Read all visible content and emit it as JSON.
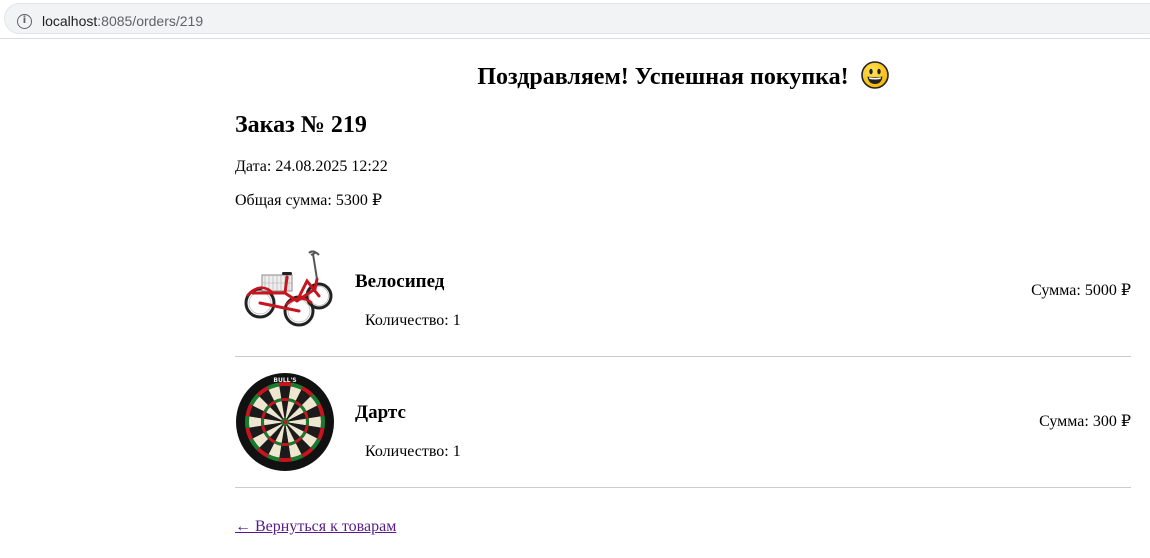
{
  "browser": {
    "url_host": "localhost",
    "url_path": ":8085/orders/219"
  },
  "page": {
    "congrats_text": "Поздравляем! Успешная покупка!",
    "congrats_emoji": "grinning-face",
    "order_title": "Заказ № 219",
    "date_text": "Дата: 24.08.2025 12:22",
    "total_text": "Общая сумма: 5300 ₽"
  },
  "items": [
    {
      "name": "Велосипед",
      "quantity_text": "Количество: 1",
      "sum_text": "Сумма: 5000 ₽",
      "image": "tricycle-image"
    },
    {
      "name": "Дартс",
      "quantity_text": "Количество: 1",
      "sum_text": "Сумма: 300 ₽",
      "image": "dartboard-image"
    }
  ],
  "back_link_text": "← Вернуться к товарам",
  "colors": {
    "link_visited": "#551a8b",
    "divider": "#cccccc",
    "bike_red": "#c8141e"
  }
}
